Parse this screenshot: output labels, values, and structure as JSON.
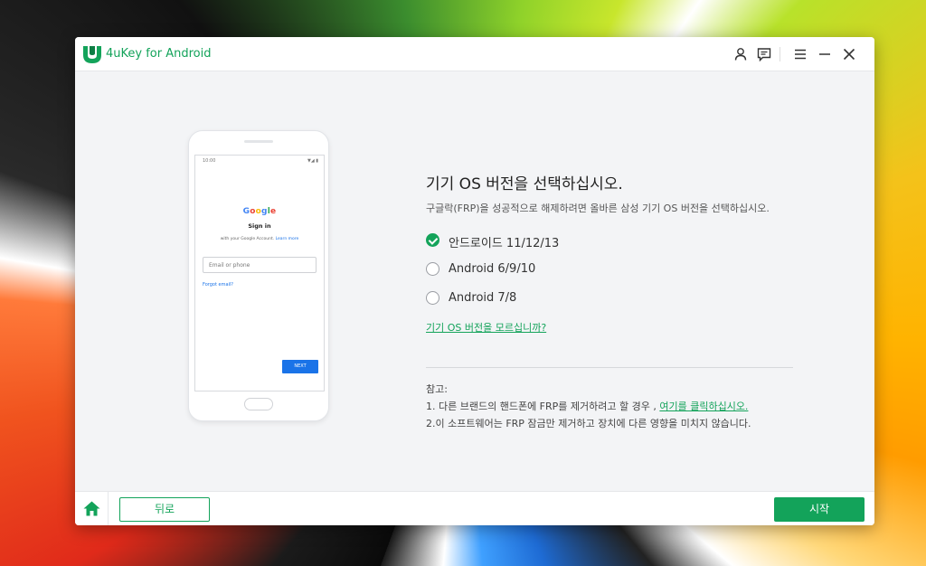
{
  "window": {
    "app_title": "4uKey for Android",
    "accent_color": "#13a35a"
  },
  "titlebar": {
    "icons": [
      "user-icon",
      "feedback-icon",
      "menu-icon",
      "minimize-icon",
      "close-icon"
    ]
  },
  "phone_mock": {
    "time": "10:00",
    "status": "▼◢ ▮",
    "google": "Google",
    "sign_in": "Sign in",
    "subtitle_prefix": "with your Google Account.",
    "subtitle_link": "Learn more",
    "email_placeholder": "Email or phone",
    "forgot": "Forgot email?",
    "next": "NEXT"
  },
  "main": {
    "heading": "기기 OS 버전을 선택하십시오.",
    "subheading": "구글락(FRP)을 성공적으로 해제하려면 올바른 삼성 기기 OS 버전을 선택하십시오.",
    "options": [
      {
        "label": "안드로이드 11/12/13",
        "selected": true
      },
      {
        "label": "Android 6/9/10",
        "selected": false
      },
      {
        "label": "Android 7/8",
        "selected": false
      }
    ],
    "unknown_link": "기기 OS 버전을 모르십니까?",
    "notes_title": "참고:",
    "note1_text": "1. 다른 브랜드의 핸드폰에 FRP를 제거하려고 할 경우 ,",
    "note1_link": "여기를 클릭하십시오.",
    "note2_text": "2.이 소프트웨어는 FRP 잠금만 제거하고 장치에 다른 영향을 미치지 않습니다."
  },
  "footer": {
    "back_label": "뒤로",
    "start_label": "시작"
  }
}
